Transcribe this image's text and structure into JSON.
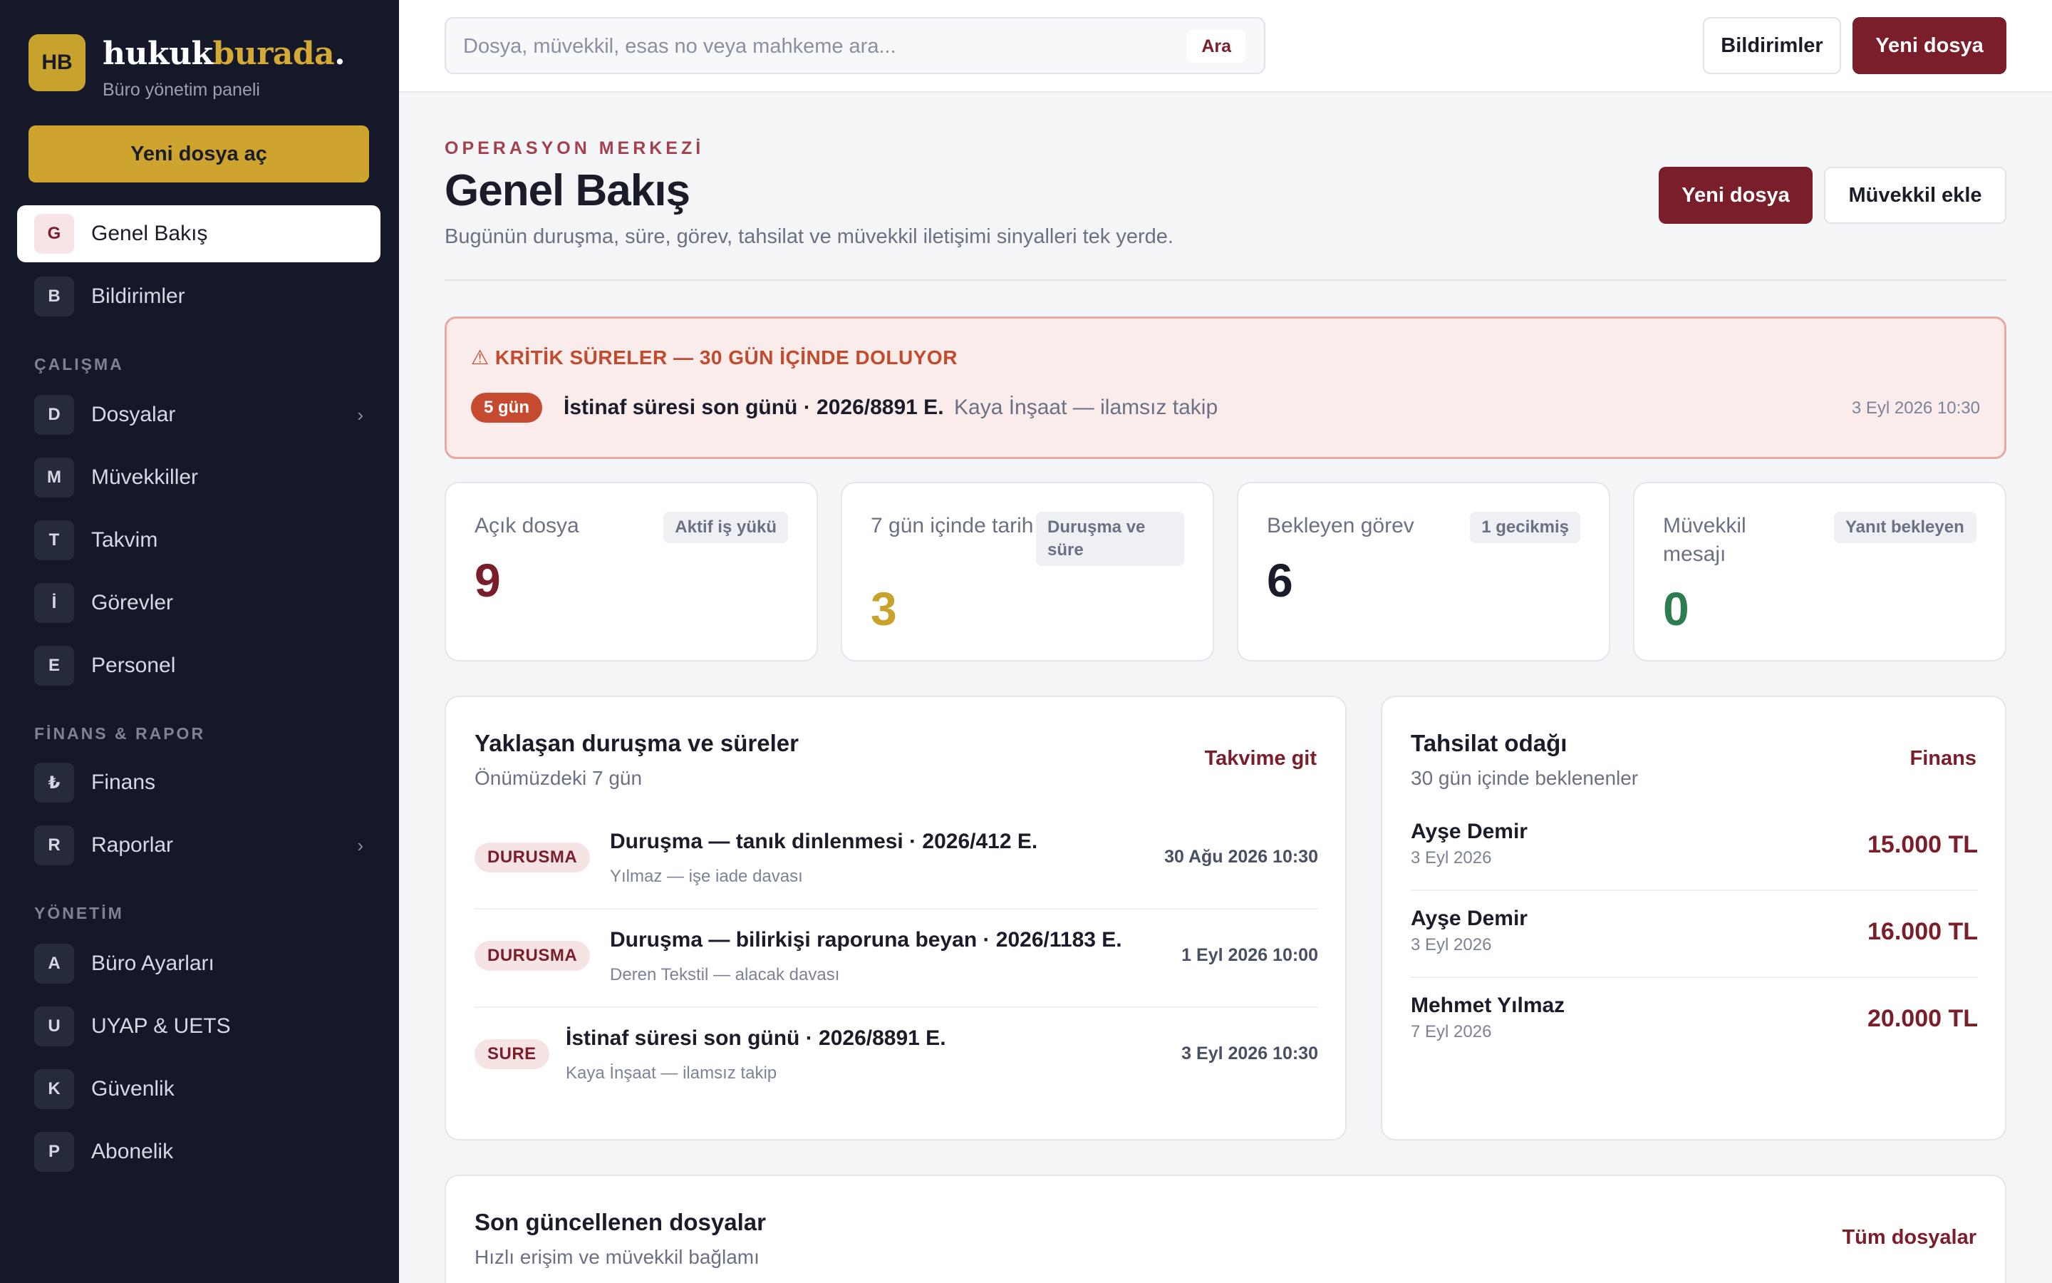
{
  "brand": {
    "badge": "HB",
    "name_part1": "hukuk",
    "name_part2": "burada",
    "name_part3": ".",
    "subtitle": "Büro yönetim paneli"
  },
  "sidebar": {
    "new_file_label": "Yeni dosya aç",
    "top_items": [
      {
        "letter": "G",
        "label": "Genel Bakış",
        "active": true
      },
      {
        "letter": "B",
        "label": "Bildirimler"
      }
    ],
    "sections": [
      {
        "title": "ÇALIŞMA",
        "items": [
          {
            "letter": "D",
            "label": "Dosyalar",
            "chevron": "›"
          },
          {
            "letter": "M",
            "label": "Müvekkiller"
          },
          {
            "letter": "T",
            "label": "Takvim"
          },
          {
            "letter": "İ",
            "label": "Görevler"
          },
          {
            "letter": "E",
            "label": "Personel"
          }
        ]
      },
      {
        "title": "FİNANS & RAPOR",
        "items": [
          {
            "letter": "₺",
            "label": "Finans"
          },
          {
            "letter": "R",
            "label": "Raporlar",
            "chevron": "›"
          }
        ]
      },
      {
        "title": "YÖNETİM",
        "items": [
          {
            "letter": "A",
            "label": "Büro Ayarları"
          },
          {
            "letter": "U",
            "label": "UYAP & UETS"
          },
          {
            "letter": "K",
            "label": "Güvenlik"
          },
          {
            "letter": "P",
            "label": "Abonelik"
          }
        ]
      }
    ]
  },
  "topbar": {
    "search_placeholder": "Dosya, müvekkil, esas no veya mahkeme ara...",
    "search_button": "Ara",
    "notifications_button": "Bildirimler",
    "new_file_button": "Yeni dosya"
  },
  "header": {
    "eyebrow": "OPERASYON MERKEZİ",
    "title": "Genel Bakış",
    "description": "Bugünün duruşma, süre, görev, tahsilat ve müvekkil iletişimi sinyalleri tek yerde.",
    "new_file_button": "Yeni dosya",
    "add_client_button": "Müvekkil ekle"
  },
  "alert": {
    "title": "⚠ KRİTİK SÜRELER — 30 GÜN İÇİNDE DOLUYOR",
    "pill": "5 gün",
    "main": "İstinaf süresi son günü · 2026/8891 E.",
    "sub": "Kaya İnşaat — ilamsız takip",
    "date": "3 Eyl 2026 10:30"
  },
  "stats": [
    {
      "label": "Açık dosya",
      "badge": "Aktif iş yükü",
      "value": "9",
      "color": "#7a1e2b"
    },
    {
      "label": "7 gün içinde tarih",
      "badge": "Duruşma ve süre",
      "value": "3",
      "color": "#c9a22b"
    },
    {
      "label": "Bekleyen görev",
      "badge": "1 gecikmiş",
      "value": "6",
      "color": "#1a1d29"
    },
    {
      "label": "Müvekkil mesajı",
      "badge": "Yanıt bekleyen",
      "value": "0",
      "color": "#2e7d4f"
    }
  ],
  "upcoming": {
    "title": "Yaklaşan duruşma ve süreler",
    "subtitle": "Önümüzdeki 7 gün",
    "link": "Takvime git",
    "items": [
      {
        "tag": "DURUSMA",
        "title": "Duruşma — tanık dinlenmesi · 2026/412 E.",
        "sub": "Yılmaz — işe iade davası",
        "date": "30 Ağu 2026 10:30"
      },
      {
        "tag": "DURUSMA",
        "title": "Duruşma — bilirkişi raporuna beyan · 2026/1183 E.",
        "sub": "Deren Tekstil — alacak davası",
        "date": "1 Eyl 2026 10:00"
      },
      {
        "tag": "SURE",
        "title": "İstinaf süresi son günü · 2026/8891 E.",
        "sub": "Kaya İnşaat — ilamsız takip",
        "date": "3 Eyl 2026 10:30"
      }
    ]
  },
  "collections": {
    "title": "Tahsilat odağı",
    "subtitle": "30 gün içinde beklenenler",
    "link": "Finans",
    "items": [
      {
        "name": "Ayşe Demir",
        "date": "3 Eyl 2026",
        "amount": "15.000 TL"
      },
      {
        "name": "Ayşe Demir",
        "date": "3 Eyl 2026",
        "amount": "16.000 TL"
      },
      {
        "name": "Mehmet Yılmaz",
        "date": "7 Eyl 2026",
        "amount": "20.000 TL"
      }
    ]
  },
  "recent": {
    "title": "Son güncellenen dosyalar",
    "subtitle": "Hızlı erişim ve müvekkil bağlamı",
    "link": "Tüm dosyalar"
  }
}
